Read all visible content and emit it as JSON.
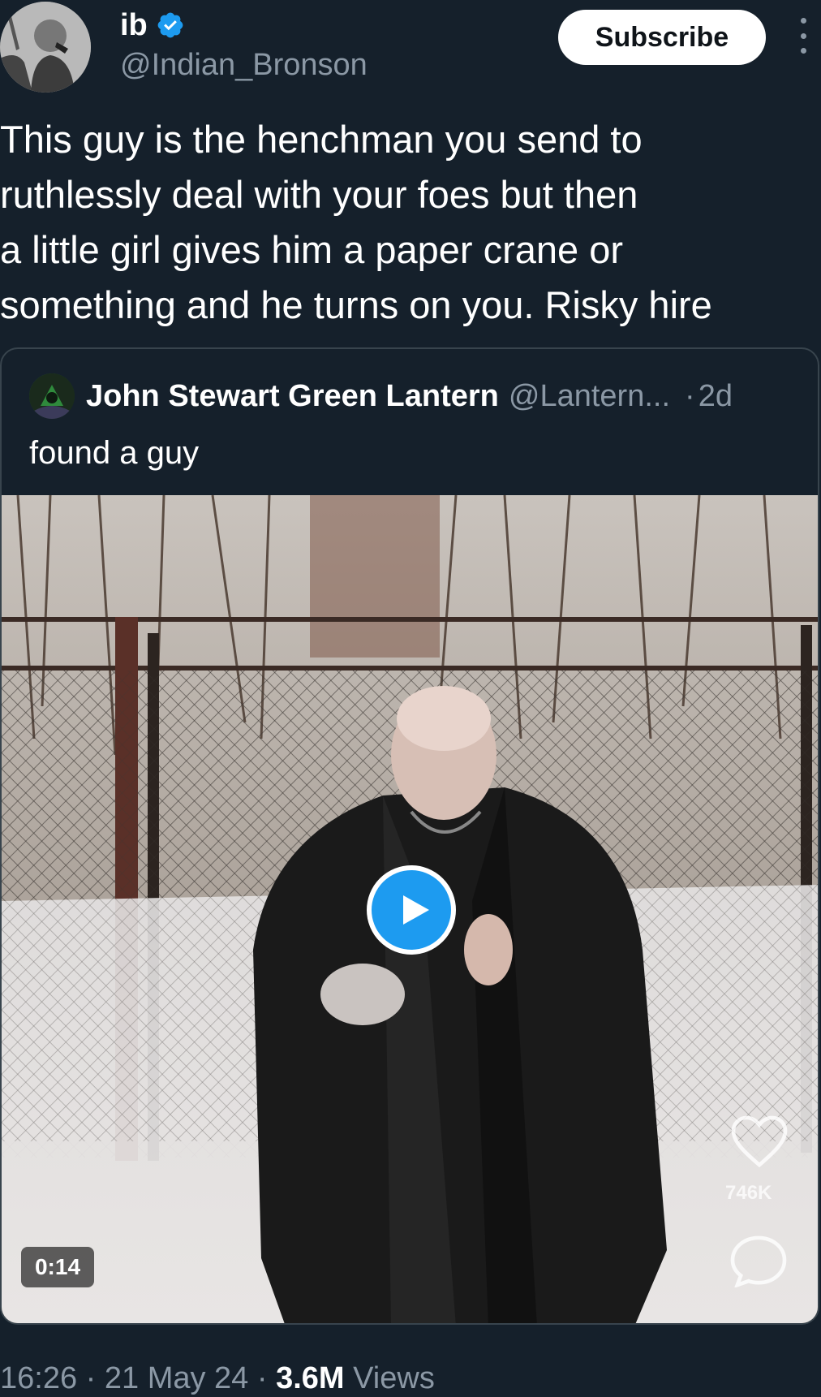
{
  "author": {
    "name": "ib",
    "handle": "@Indian_Bronson",
    "verified": true
  },
  "header": {
    "subscribe_label": "Subscribe"
  },
  "tweet": {
    "text": "This guy is the henchman you send to\nruthlessly deal with your foes but then\na little girl gives him a paper crane or\nsomething and he turns on you. Risky hire"
  },
  "quote": {
    "name": "John Stewart Green Lantern",
    "handle": "@Lantern...",
    "separator": "·",
    "time": "2d",
    "text": "found a guy",
    "media": {
      "duration": "0:14",
      "overlay_likes": "746K"
    }
  },
  "meta": {
    "time": "16:26",
    "sep1": " · ",
    "date": "21 May 24",
    "sep2": " · ",
    "views_count": "3.6M",
    "views_label": " Views"
  },
  "colors": {
    "background": "#15202b",
    "accent": "#1d9bf0",
    "secondary_text": "#8b98a5",
    "border": "#38444d"
  },
  "icons": [
    "verified-badge-icon",
    "more-options-icon",
    "play-icon",
    "heart-icon",
    "comment-icon"
  ]
}
